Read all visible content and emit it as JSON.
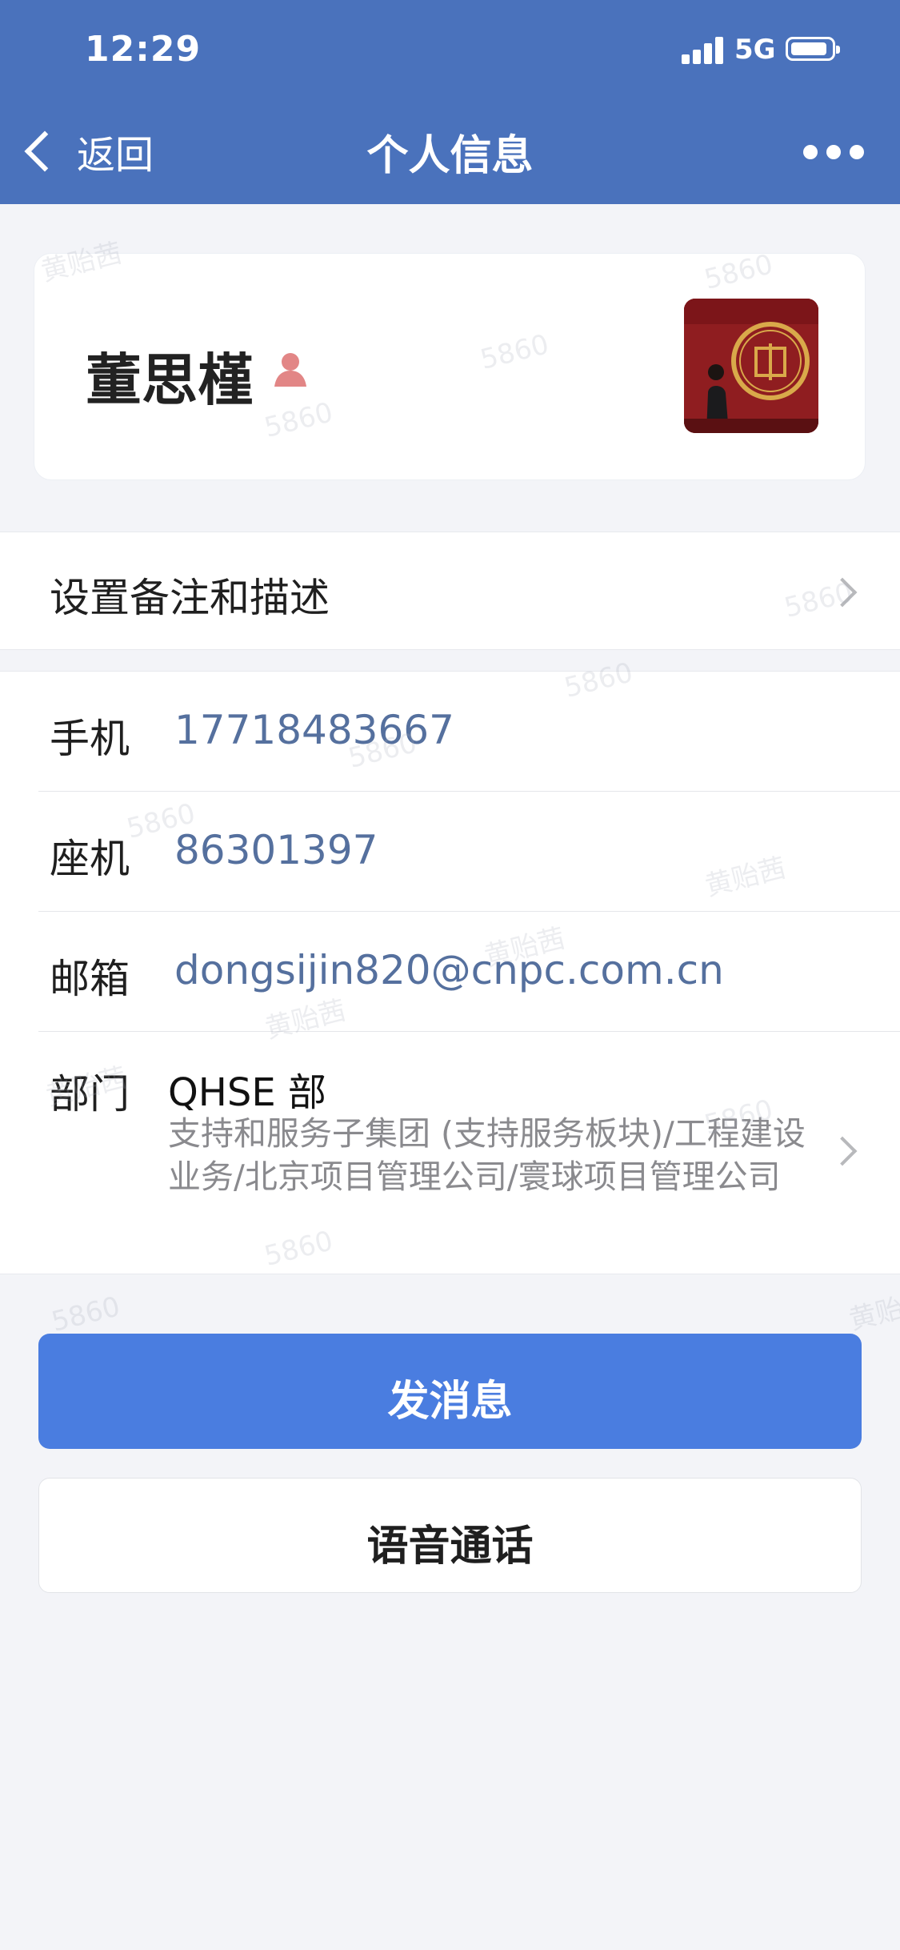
{
  "status_bar": {
    "time": "12:29",
    "network": "5G"
  },
  "nav": {
    "back_label": "返回",
    "title": "个人信息"
  },
  "profile": {
    "name": "董思槿"
  },
  "remark": {
    "label": "设置备注和描述"
  },
  "info": {
    "phone_label": "手机",
    "phone_value": "17718483667",
    "landline_label": "座机",
    "landline_value": "86301397",
    "email_label": "邮箱",
    "email_value": "dongsijin820@cnpc.com.cn",
    "dept_label": "部门",
    "dept_name": "QHSE 部",
    "dept_path": "支持和服务子集团 (支持服务板块)/工程建设业务/北京项目管理公司/寰球项目管理公司"
  },
  "actions": {
    "send_message": "发消息",
    "voice_call": "语音通话"
  },
  "colors": {
    "header_bg": "#4a72bc",
    "primary": "#4a7de0",
    "link": "#55709e"
  },
  "watermark": {
    "number": "5860",
    "name": "黄贻茜"
  }
}
